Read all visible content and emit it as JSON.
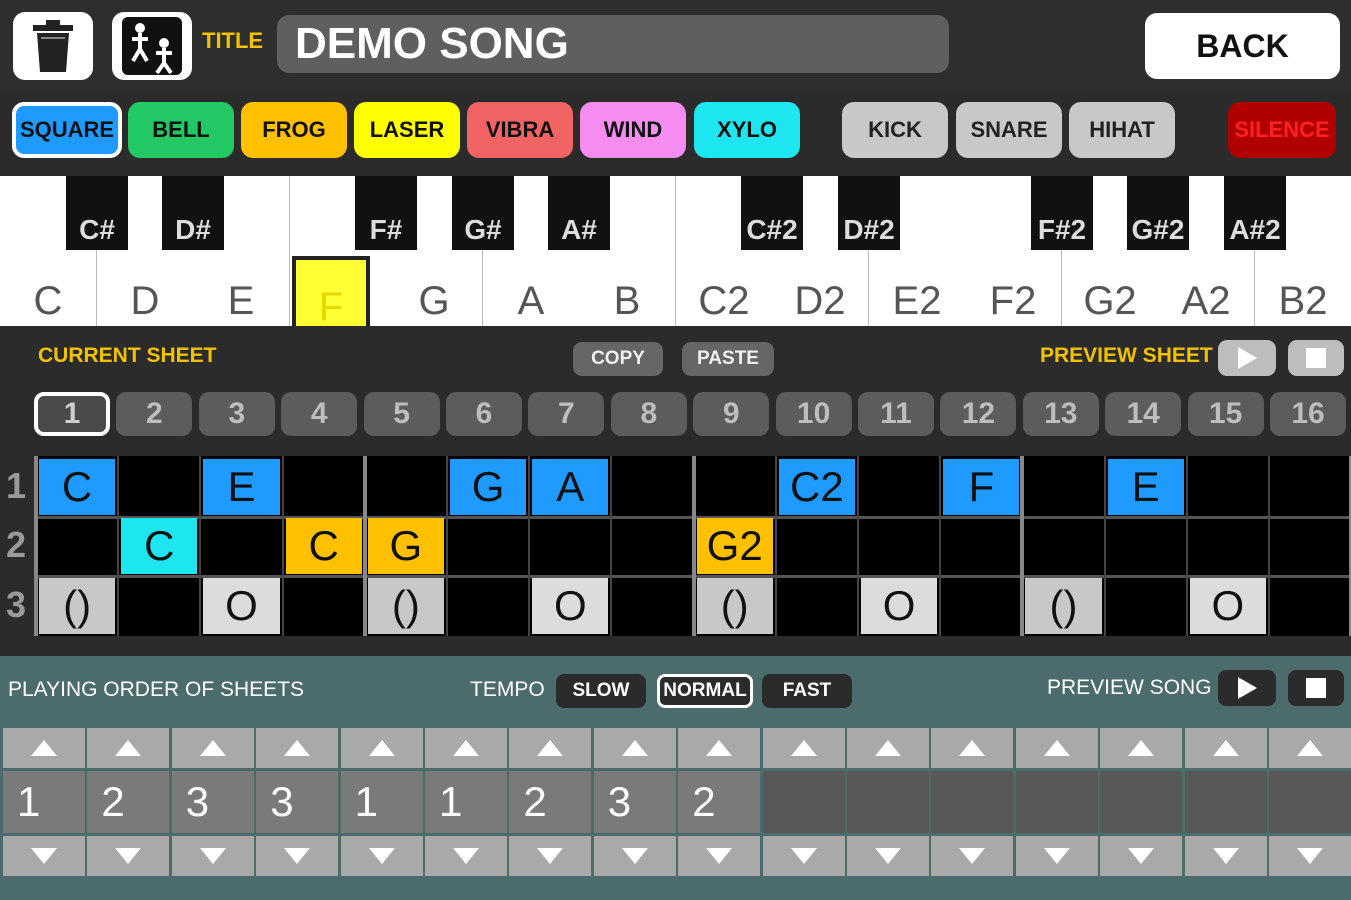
{
  "header": {
    "title_label": "TITLE",
    "title_value": "DEMO SONG",
    "back_label": "BACK"
  },
  "instruments": [
    {
      "label": "SQUARE",
      "color": "#1f9bff",
      "selected": true
    },
    {
      "label": "BELL",
      "color": "#22c864"
    },
    {
      "label": "FROG",
      "color": "#ffc000"
    },
    {
      "label": "LASER",
      "color": "#ffff00"
    },
    {
      "label": "VIBRA",
      "color": "#f26464"
    },
    {
      "label": "WIND",
      "color": "#f58cf0"
    },
    {
      "label": "XYLO",
      "color": "#1ee6f0"
    }
  ],
  "drums": [
    {
      "label": "KICK"
    },
    {
      "label": "SNARE"
    },
    {
      "label": "HIHAT"
    }
  ],
  "silence_label": "SILENCE",
  "keyboard": {
    "white_keys": [
      "C",
      "D",
      "E",
      "F",
      "G",
      "A",
      "B",
      "C2",
      "D2",
      "E2",
      "F2",
      "G2",
      "A2",
      "B2"
    ],
    "black_keys": [
      "C#",
      "D#",
      "F#",
      "G#",
      "A#",
      "C#2",
      "D#2",
      "F#2",
      "G#2",
      "A#2"
    ],
    "highlighted": "F"
  },
  "sheet": {
    "current_label": "CURRENT SHEET",
    "copy_label": "COPY",
    "paste_label": "PASTE",
    "preview_label": "PREVIEW SHEET",
    "tabs": [
      "1",
      "2",
      "3",
      "4",
      "5",
      "6",
      "7",
      "8",
      "9",
      "10",
      "11",
      "12",
      "13",
      "14",
      "15",
      "16"
    ],
    "selected_tab": "1",
    "row_labels": [
      "1",
      "2",
      "3"
    ],
    "rows": [
      [
        {
          "t": "C",
          "c": "#1f9bff"
        },
        {
          "t": "",
          "c": ""
        },
        {
          "t": "E",
          "c": "#1f9bff"
        },
        {
          "t": "",
          "c": ""
        },
        {
          "t": "",
          "c": ""
        },
        {
          "t": "G",
          "c": "#1f9bff"
        },
        {
          "t": "A",
          "c": "#1f9bff"
        },
        {
          "t": "",
          "c": ""
        },
        {
          "t": "",
          "c": ""
        },
        {
          "t": "C2",
          "c": "#1f9bff"
        },
        {
          "t": "",
          "c": ""
        },
        {
          "t": "F",
          "c": "#1f9bff"
        },
        {
          "t": "",
          "c": ""
        },
        {
          "t": "E",
          "c": "#1f9bff"
        },
        {
          "t": "",
          "c": ""
        },
        {
          "t": "",
          "c": ""
        }
      ],
      [
        {
          "t": "",
          "c": ""
        },
        {
          "t": "C",
          "c": "#1ee6f0"
        },
        {
          "t": "",
          "c": ""
        },
        {
          "t": "C",
          "c": "#ffc000"
        },
        {
          "t": "G",
          "c": "#ffc000"
        },
        {
          "t": "",
          "c": ""
        },
        {
          "t": "",
          "c": ""
        },
        {
          "t": "",
          "c": ""
        },
        {
          "t": "G2",
          "c": "#ffc000"
        },
        {
          "t": "",
          "c": ""
        },
        {
          "t": "",
          "c": ""
        },
        {
          "t": "",
          "c": ""
        },
        {
          "t": "",
          "c": ""
        },
        {
          "t": "",
          "c": ""
        },
        {
          "t": "",
          "c": ""
        },
        {
          "t": "",
          "c": ""
        }
      ],
      [
        {
          "t": "()",
          "c": "#c8c8c8"
        },
        {
          "t": "",
          "c": ""
        },
        {
          "t": "O",
          "c": "#dcdcdc"
        },
        {
          "t": "",
          "c": ""
        },
        {
          "t": "()",
          "c": "#c8c8c8"
        },
        {
          "t": "",
          "c": ""
        },
        {
          "t": "O",
          "c": "#dcdcdc"
        },
        {
          "t": "",
          "c": ""
        },
        {
          "t": "()",
          "c": "#c8c8c8"
        },
        {
          "t": "",
          "c": ""
        },
        {
          "t": "O",
          "c": "#dcdcdc"
        },
        {
          "t": "",
          "c": ""
        },
        {
          "t": "()",
          "c": "#c8c8c8"
        },
        {
          "t": "",
          "c": ""
        },
        {
          "t": "O",
          "c": "#dcdcdc"
        },
        {
          "t": "",
          "c": ""
        }
      ]
    ]
  },
  "song": {
    "order_label": "PLAYING ORDER OF SHEETS",
    "tempo_label": "TEMPO",
    "tempo_options": [
      "SLOW",
      "NORMAL",
      "FAST"
    ],
    "tempo_selected": "NORMAL",
    "preview_label": "PREVIEW SONG",
    "order": [
      "1",
      "2",
      "3",
      "3",
      "1",
      "1",
      "2",
      "3",
      "2",
      "",
      "",
      "",
      "",
      "",
      "",
      ""
    ]
  },
  "icons": {
    "trash": "trash-icon",
    "share": "share-people-icon",
    "play": "play-icon",
    "stop": "stop-icon",
    "up": "arrow-up-icon",
    "down": "arrow-down-icon"
  }
}
